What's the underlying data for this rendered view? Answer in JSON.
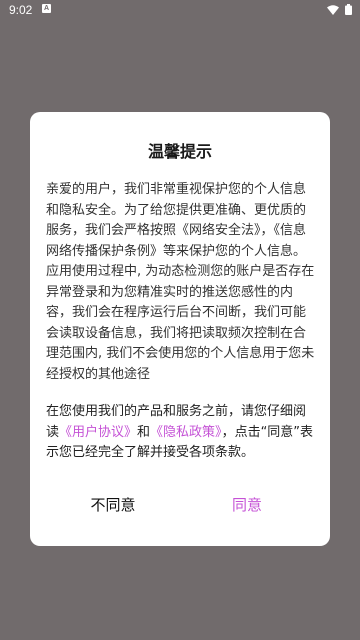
{
  "status_bar": {
    "time": "9:02",
    "notification_icon": "A",
    "icons": [
      "wifi-icon",
      "battery-icon"
    ]
  },
  "dialog": {
    "title": "温馨提示",
    "body": "亲爱的用户，我们非常重视保护您的个人信息和隐私安全。为了给您提供更准确、更优质的服务，我们会严格按照《网络安全法》，《信息网络传播保护条例》等来保护您的个人信息。应用使用过程中, 为动态检测您的账户是否存在异常登录和为您精准实时的推送您感性的内容，我们会在程序运行后台不间断，我们可能会读取设备信息，我们将把读取频次控制在合理范围内, 我们不会使用您的个人信息用于您未经授权的其他途径",
    "consent": {
      "prefix": "在您使用我们的产品和服务之前，请您仔细阅读",
      "user_agreement_link": "《用户协议》",
      "and": "和",
      "privacy_policy_link": "《隐私政策》",
      "suffix": "，点击“同意”表示您已经完全了解并接受各项条款。"
    },
    "disagree_label": "不同意",
    "agree_label": "同意"
  },
  "colors": {
    "backdrop": "#716b6c",
    "accent": "#c552d6",
    "dialog_background": "#ffffff"
  }
}
